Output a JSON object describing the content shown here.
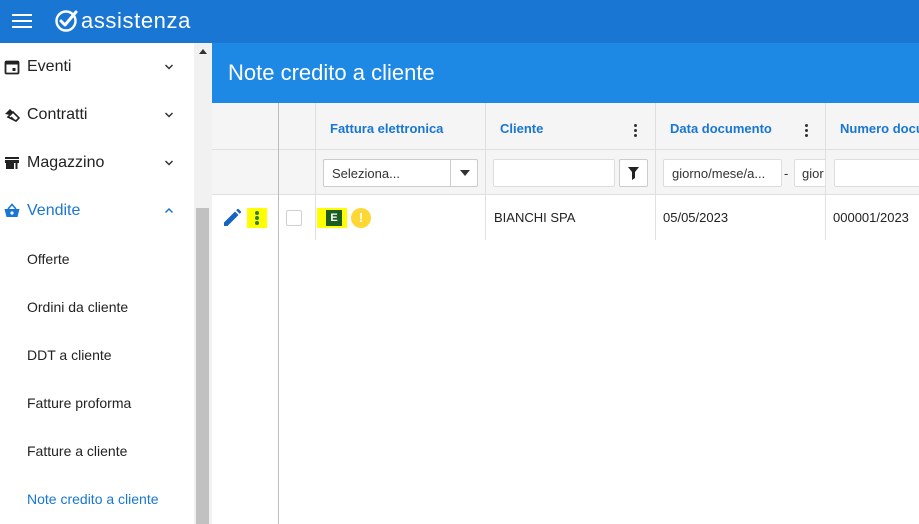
{
  "app": {
    "logo_text": "assistenza"
  },
  "sidebar": {
    "items": [
      {
        "label": "Eventi",
        "icon": "calendar-icon",
        "chevron": "chevron-down-icon"
      },
      {
        "label": "Contratti",
        "icon": "handshake-icon",
        "chevron": "chevron-down-icon"
      },
      {
        "label": "Magazzino",
        "icon": "store-icon",
        "chevron": "chevron-down-icon"
      },
      {
        "label": "Vendite",
        "icon": "basket-icon",
        "chevron": "chevron-up-icon"
      }
    ],
    "subitems": [
      {
        "label": "Offerte"
      },
      {
        "label": "Ordini da cliente"
      },
      {
        "label": "DDT a cliente"
      },
      {
        "label": "Fatture proforma"
      },
      {
        "label": "Fatture a cliente"
      },
      {
        "label": "Note credito a cliente"
      }
    ]
  },
  "page": {
    "title": "Note credito a cliente"
  },
  "grid": {
    "columns": {
      "fattura": "Fattura elettronica",
      "cliente": "Cliente",
      "data": "Data documento",
      "numero": "Numero docu"
    },
    "filters": {
      "select_value": "Seleziona...",
      "date_from": "giorno/mese/a...",
      "dash": "-",
      "date_to": "gior"
    },
    "rows": [
      {
        "badge": "E",
        "warning": "!",
        "cliente": "BIANCHI SPA",
        "data": "05/05/2023",
        "numero": "000001/2023"
      }
    ]
  },
  "colors": {
    "appbar": "#1976d2",
    "header": "#1e88e5",
    "accent": "#1976d2",
    "highlight": "#ffff00",
    "badge": "#1b5e20",
    "warning": "#fdd835"
  }
}
